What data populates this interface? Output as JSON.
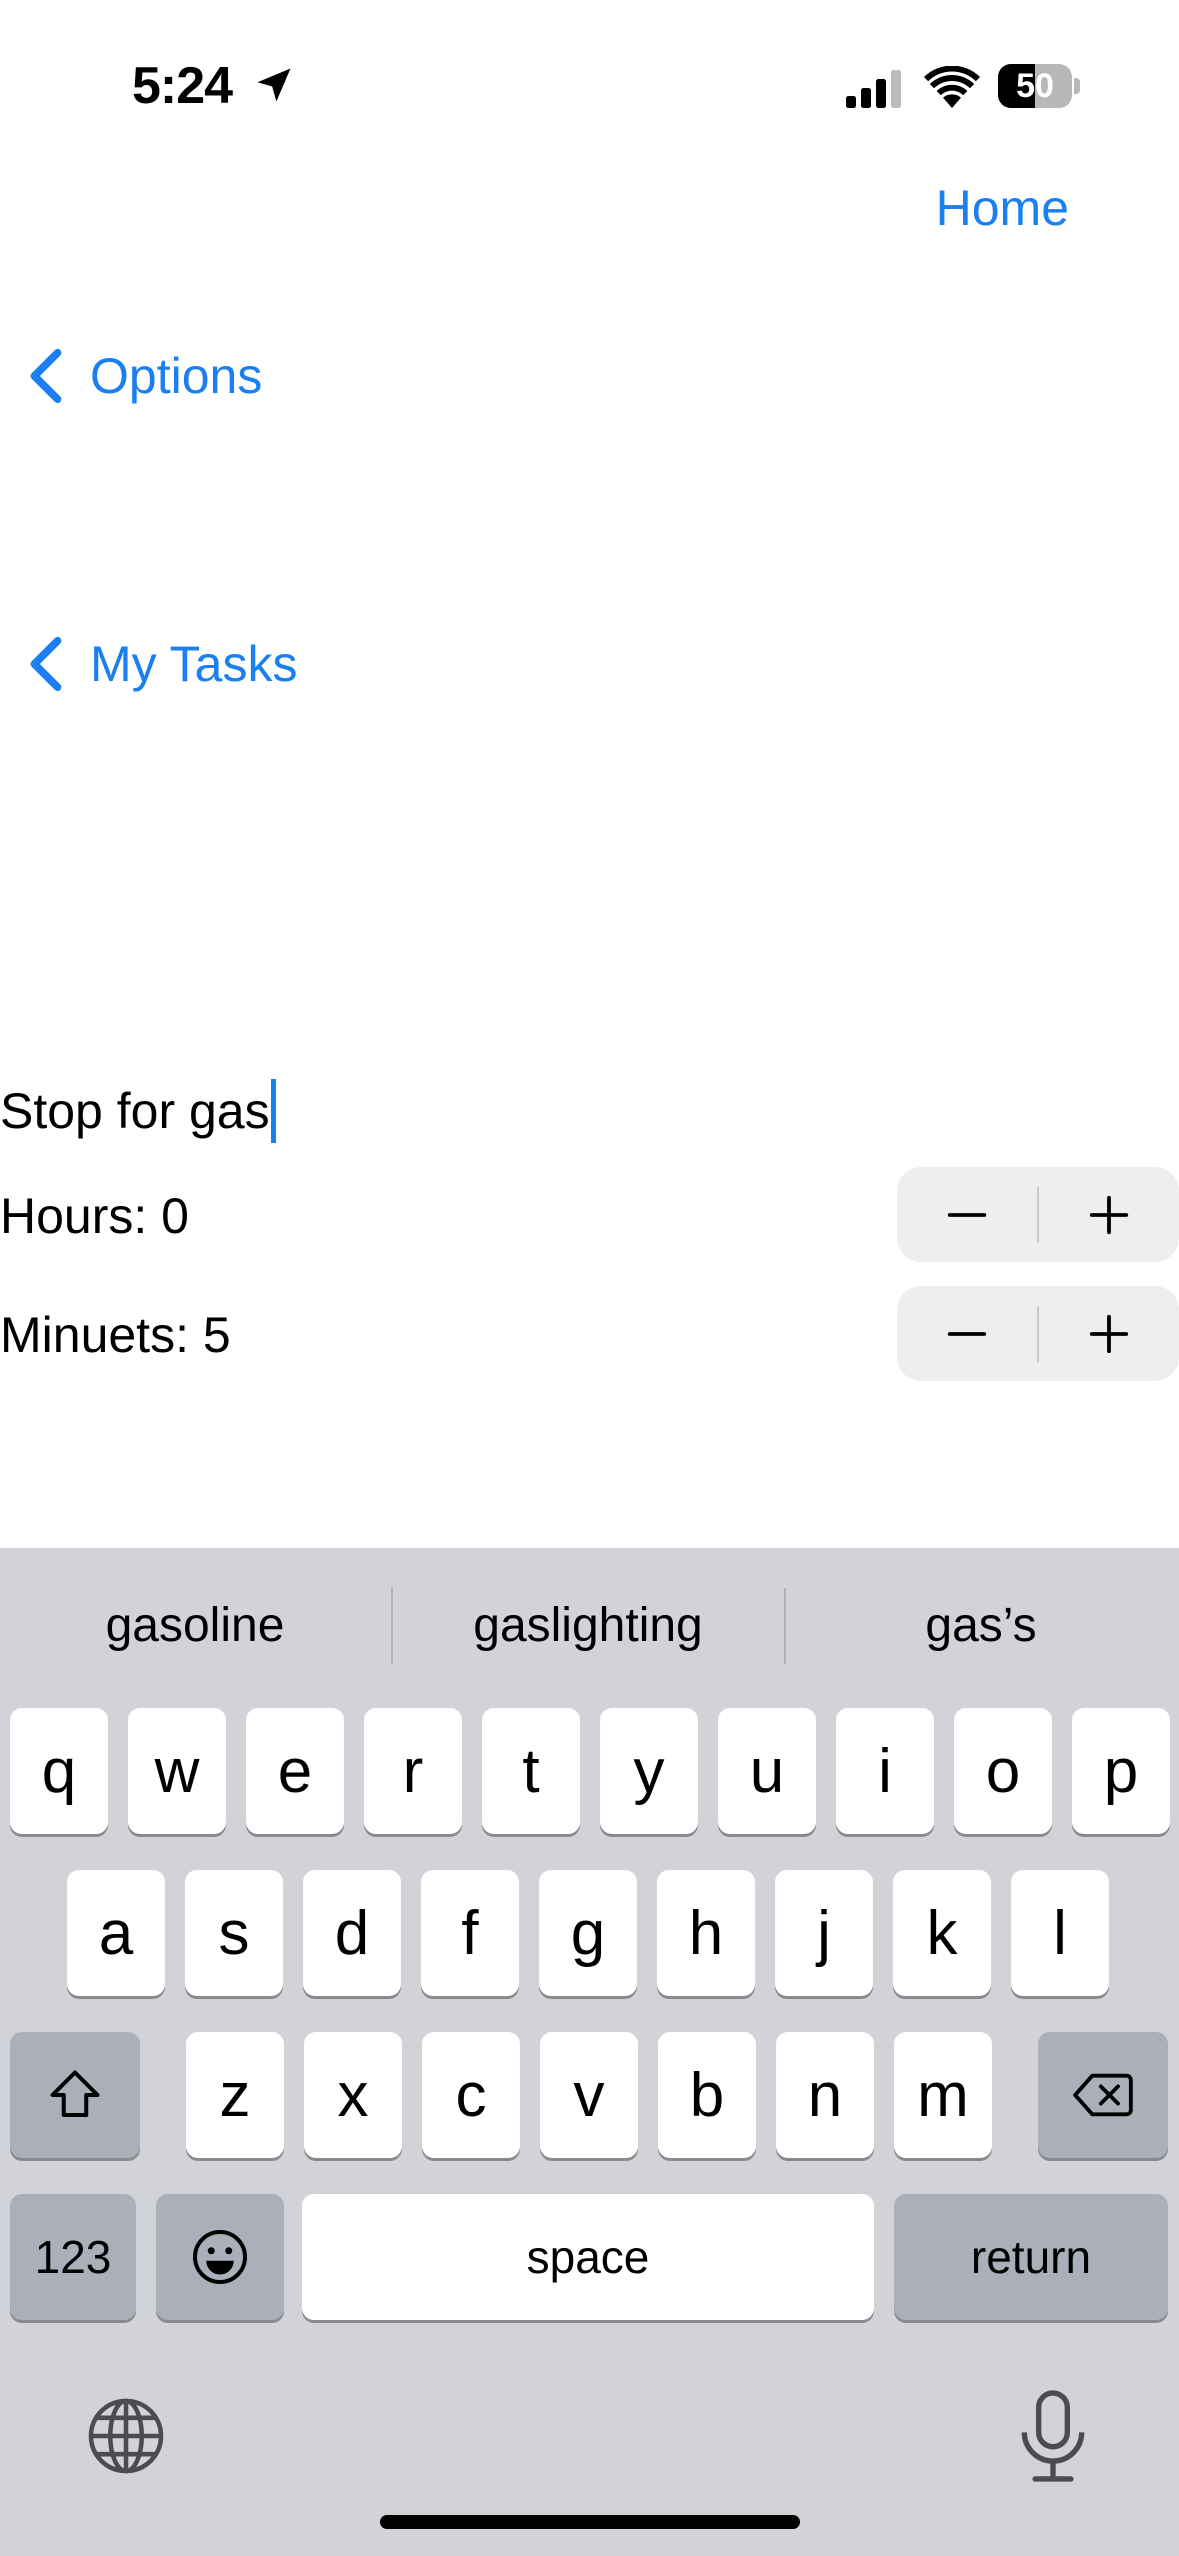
{
  "status_bar": {
    "time": "5:24",
    "battery": "50",
    "battery_level": 0.5
  },
  "nav": {
    "home_label": "Home",
    "back_options_label": "Options",
    "back_tasks_label": "My Tasks"
  },
  "task": {
    "name": "Stop for gas",
    "hours_label": "Hours: 0",
    "minutes_label": "Minuets: 5",
    "decrement_symbol": "−",
    "increment_symbol": "+"
  },
  "keyboard": {
    "suggestions": [
      "gasoline",
      "gaslighting",
      "gas’s"
    ],
    "row1": [
      "q",
      "w",
      "e",
      "r",
      "t",
      "y",
      "u",
      "i",
      "o",
      "p"
    ],
    "row2": [
      "a",
      "s",
      "d",
      "f",
      "g",
      "h",
      "j",
      "k",
      "l"
    ],
    "row3": [
      "z",
      "x",
      "c",
      "v",
      "b",
      "n",
      "m"
    ],
    "numbers_label": "123",
    "space_label": "space",
    "return_label": "return"
  },
  "colors": {
    "accent": "#1a7ff0",
    "keyboard_bg": "#d1d3d9",
    "key_bg": "#ffffff",
    "key_dark": "#abafb9"
  },
  "icons": [
    "location-arrow-icon",
    "signal-icon",
    "wifi-icon",
    "battery-icon",
    "chevron-left-icon",
    "minus-icon",
    "plus-icon",
    "shift-icon",
    "backspace-icon",
    "emoji-icon",
    "globe-icon",
    "microphone-icon"
  ]
}
